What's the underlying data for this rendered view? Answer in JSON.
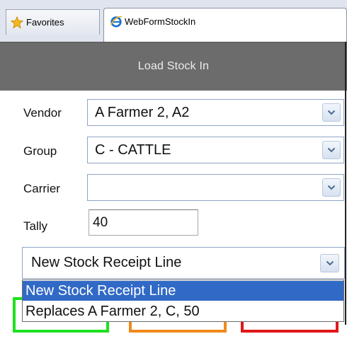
{
  "browser": {
    "favorites_label": "Favorites",
    "tab_title": "WebFormStockIn"
  },
  "header": {
    "title": "Load Stock In"
  },
  "form": {
    "vendor": {
      "label": "Vendor",
      "value": "A Farmer 2, A2"
    },
    "group": {
      "label": "Group",
      "value": "C - CATTLE"
    },
    "carrier": {
      "label": "Carrier",
      "value": ""
    },
    "tally": {
      "label": "Tally",
      "value": "40"
    },
    "line_select": {
      "value": "New Stock Receipt Line",
      "options": [
        "New Stock Receipt Line",
        "Replaces A Farmer 2, C, 50"
      ],
      "selected_index": 0
    }
  },
  "colors": {
    "header_bg": "#6c6c6c",
    "selection": "#3169c6",
    "button_green": "#1fe01f",
    "button_orange": "#f28a1a",
    "button_red": "#e01818"
  },
  "icons": [
    "star-icon",
    "ie-icon",
    "chevron-down-icon"
  ]
}
